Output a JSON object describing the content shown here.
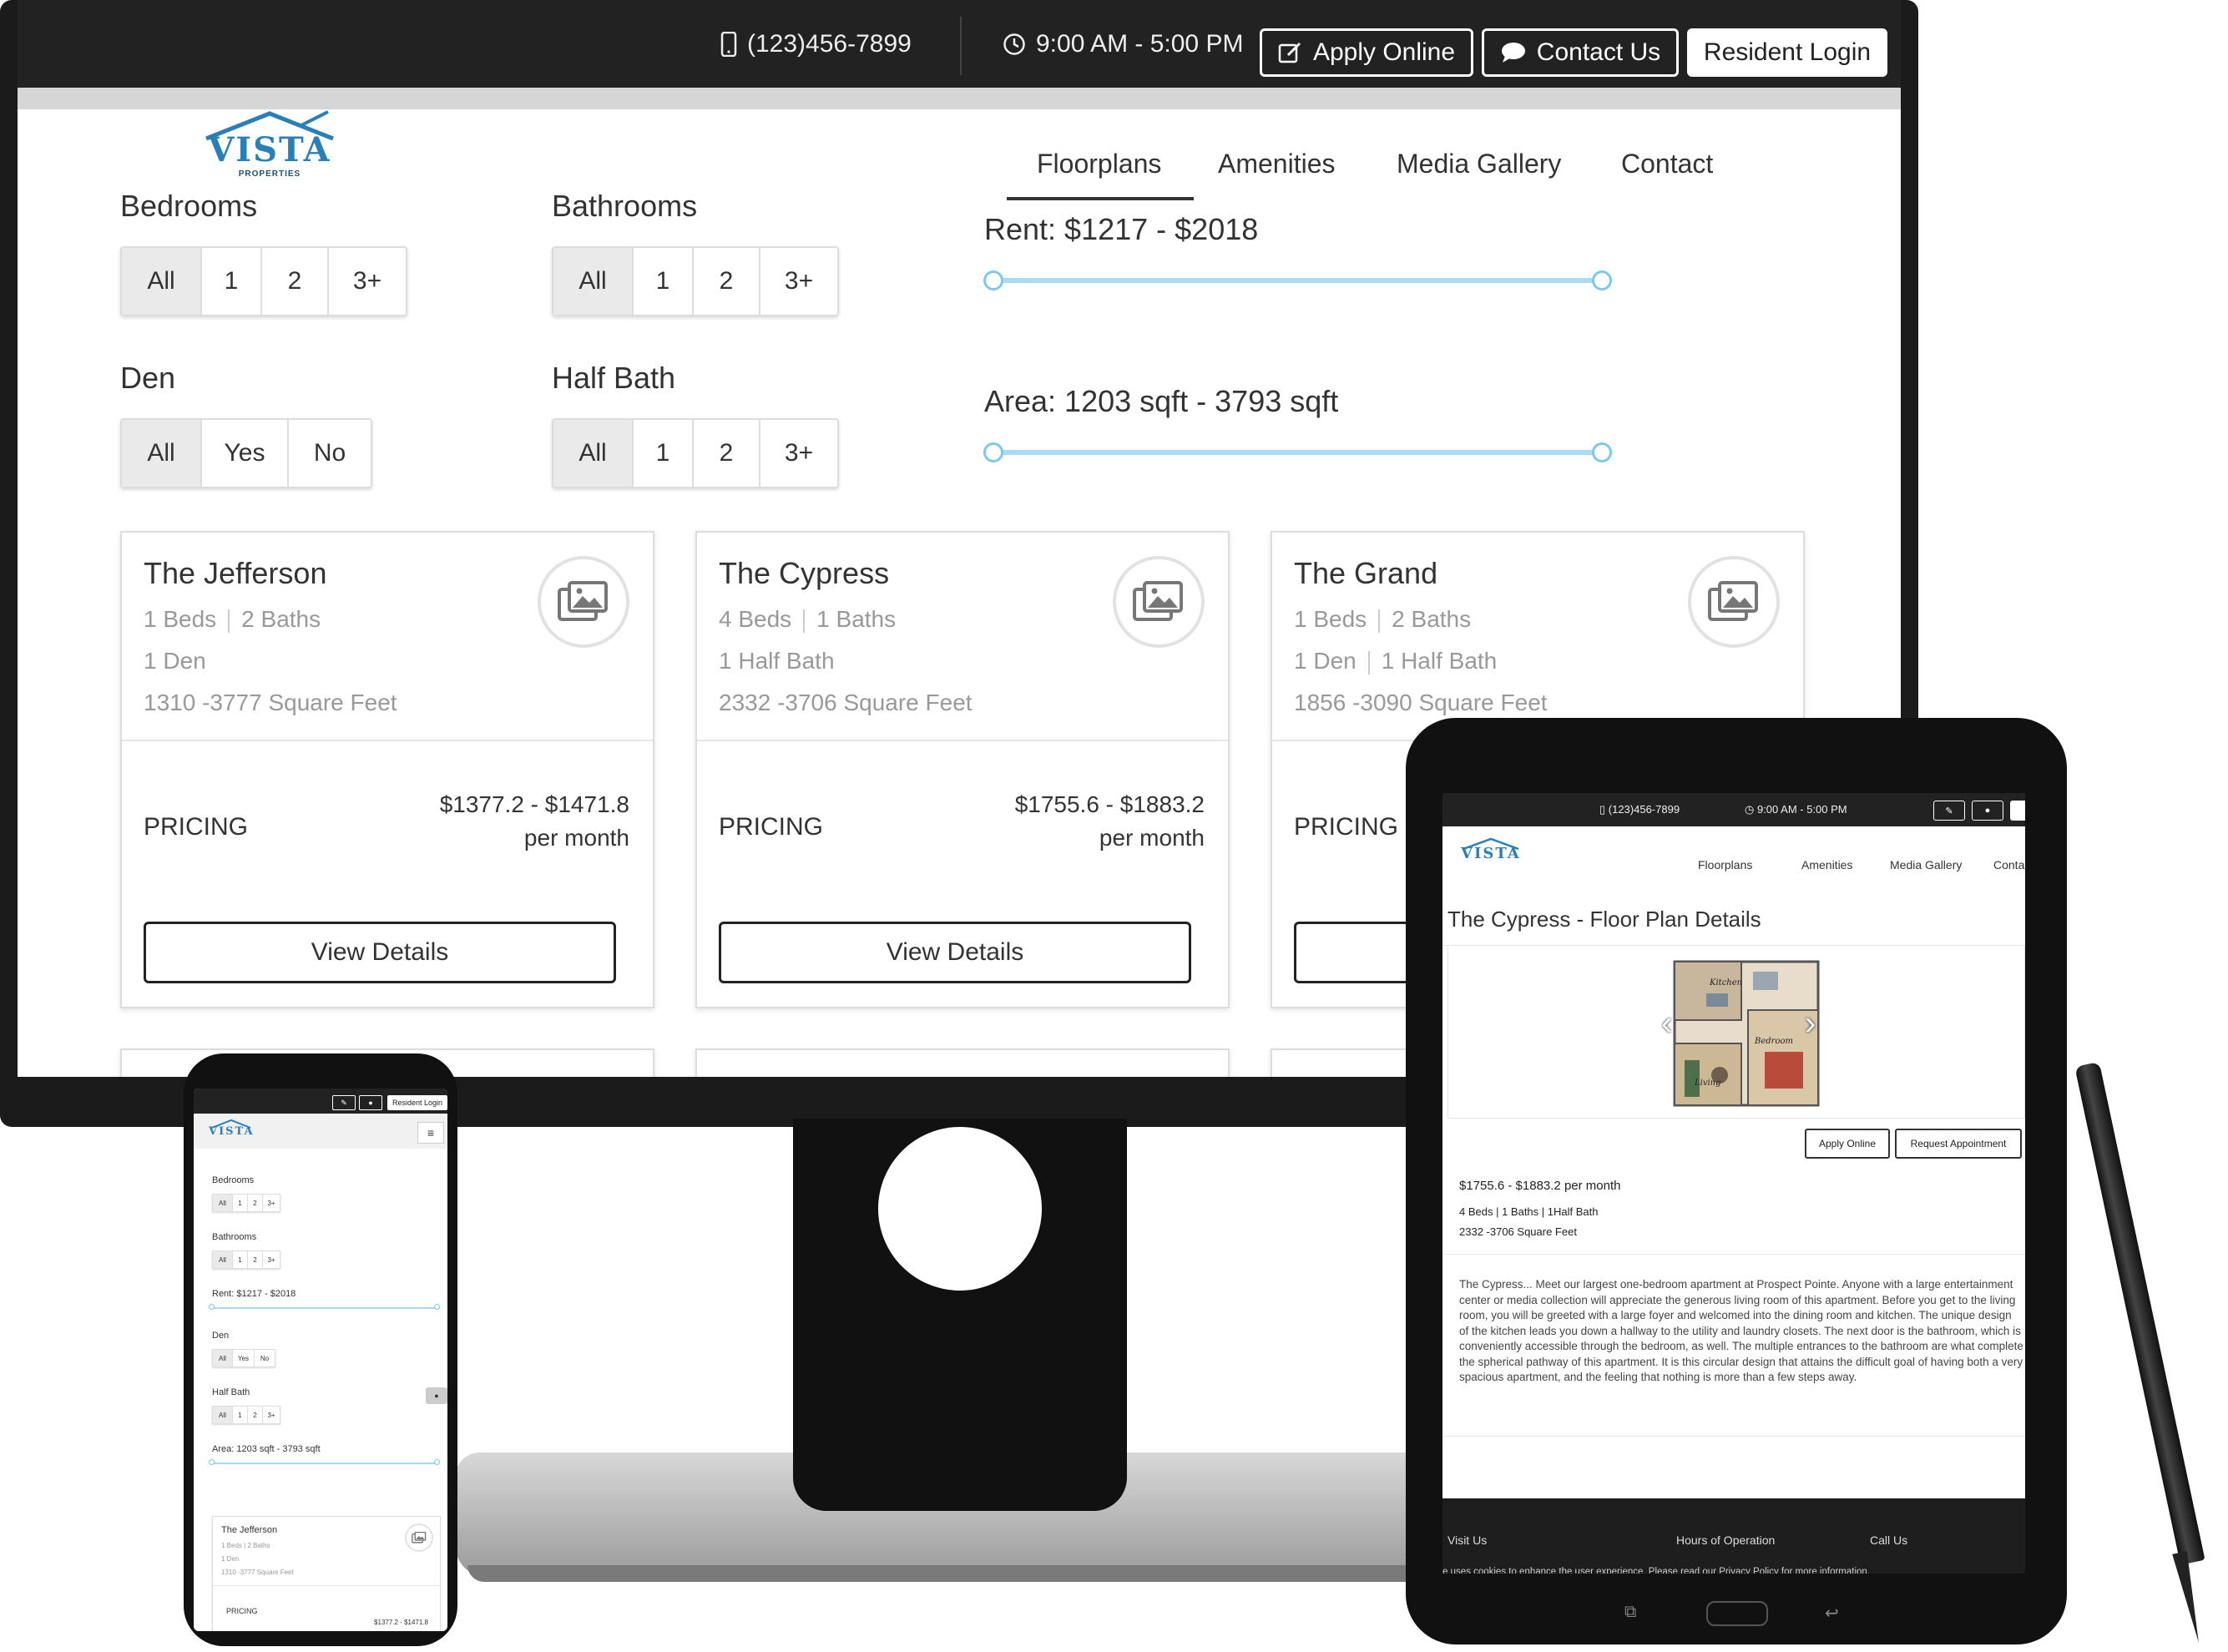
{
  "desktop": {
    "topbar": {
      "phone": "(123)456-7899",
      "hours": "9:00 AM - 5:00 PM",
      "apply_online": "Apply Online",
      "contact_us": "Contact Us",
      "resident_login": "Resident Login"
    },
    "logo": {
      "wordmark": "VISTA",
      "sub": "PROPERTIES"
    },
    "nav": [
      "Floorplans",
      "Amenities",
      "Media Gallery",
      "Contact"
    ],
    "filters": {
      "bedrooms_label": "Bedrooms",
      "bathrooms_label": "Bathrooms",
      "den_label": "Den",
      "halfbath_label": "Half Bath",
      "bedrooms_options": [
        "All",
        "1",
        "2",
        "3+"
      ],
      "bathrooms_options": [
        "All",
        "1",
        "2",
        "3+"
      ],
      "den_options": [
        "All",
        "Yes",
        "No"
      ],
      "halfbath_options": [
        "All",
        "1",
        "2",
        "3+"
      ],
      "rent_label": "Rent: $1217 - $2018",
      "area_label": "Area: 1203 sqft - 3793 sqft"
    },
    "cards": [
      {
        "title": "The Jefferson",
        "beds": "1 Beds",
        "baths": "2 Baths",
        "line2": "1 Den",
        "line2b": "",
        "sqft": "1310 -3777 Square Feet",
        "pricing": "PRICING",
        "price": "$1377.2 - $1471.8",
        "per": "per month",
        "button": "View Details"
      },
      {
        "title": "The Cypress",
        "beds": "4 Beds",
        "baths": "1 Baths",
        "line2": "1 Half Bath",
        "line2b": "",
        "sqft": "2332 -3706 Square Feet",
        "pricing": "PRICING",
        "price": "$1755.6 - $1883.2",
        "per": "per month",
        "button": "View Details"
      },
      {
        "title": "The Grand",
        "beds": "1 Beds",
        "baths": "2 Baths",
        "line2": "1 Den",
        "line2b": "1 Half Bath",
        "sqft": "1856 -3090 Square Feet",
        "pricing": "PRICING",
        "price": "",
        "per": "",
        "button": ""
      }
    ]
  },
  "phone": {
    "resident_login": "Resident Login",
    "logo": "VISTA",
    "bedrooms_label": "Bedrooms",
    "bathrooms_label": "Bathrooms",
    "rent_label": "Rent: $1217 - $2018",
    "den_label": "Den",
    "halfbath_label": "Half Bath",
    "area_label": "Area: 1203 sqft - 3793 sqft",
    "options4": [
      "All",
      "1",
      "2",
      "3+"
    ],
    "den_options": [
      "All",
      "Yes",
      "No"
    ],
    "card": {
      "title": "The Jefferson",
      "beds": "1 Beds | 2 Baths",
      "den": "1 Den",
      "sqft": "1310 -3777 Square Feet",
      "pricing": "PRICING",
      "price": "$1377.2 - $1471.8"
    }
  },
  "tablet": {
    "phone": "(123)456-7899",
    "hours": "9:00 AM - 5:00 PM",
    "logo": "VISTA",
    "nav": [
      "Floorplans",
      "Amenities",
      "Media Gallery",
      "Contact"
    ],
    "heading": "The Cypress - Floor Plan Details",
    "floorplan_labels": [
      "Kitchen",
      "Bedroom",
      "Living"
    ],
    "apply_online": "Apply Online",
    "request_appointment": "Request Appointment",
    "price": "$1755.6 - $1883.2 per month",
    "beds_baths": "4 Beds  |  1 Baths  |  1Half Bath",
    "sqft": "2332 -3706 Square Feet",
    "description": "The Cypress... Meet our largest one-bedroom apartment at Prospect Pointe. Anyone with a large entertainment center or media collection will appreciate the generous living room of this apartment. Before you get to the living room, you will be greeted with a large foyer and welcomed into the dining room and kitchen. The unique design of the kitchen leads you down a hallway to the utility and laundry closets. The next door is the bathroom, which is conveniently accessible through the bedroom, as well. The multiple entrances to the bathroom are what complete the spherical pathway of this apartment. It is this circular design that attains the difficult goal of having both a very spacious apartment, and the feeling that nothing is more than a few steps away.",
    "footer": {
      "visit": "Visit Us",
      "hours": "Hours of Operation",
      "call": "Call Us",
      "cookie": "e uses cookies to enhance the user experience. Please read our Privacy Policy for more information."
    }
  },
  "colors": {
    "accent": "#2a7fb8",
    "slider": "#a9dbf2",
    "topbar": "#222222"
  },
  "icons": [
    "phone-icon",
    "clock-icon",
    "edit-icon",
    "chat-icon",
    "image-icon",
    "menu-icon",
    "chevron-left-icon",
    "chevron-right-icon"
  ]
}
